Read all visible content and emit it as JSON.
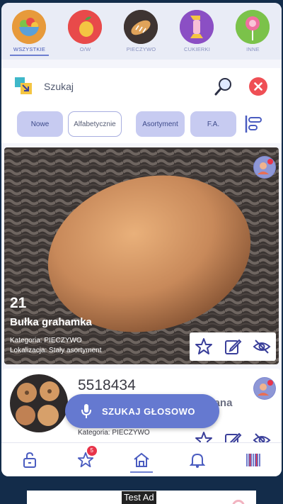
{
  "categories": [
    {
      "label": "WSZYSTKIE",
      "icon": "salad-bowl-icon",
      "color": "#e79a3b",
      "active": true
    },
    {
      "label": "O/W",
      "icon": "fruit-icon",
      "color": "#e84a4a",
      "active": false
    },
    {
      "label": "PIECZYWO",
      "icon": "bread-icon",
      "color": "#3e3432",
      "active": false
    },
    {
      "label": "CUKIERKI",
      "icon": "candy-icon",
      "color": "#8b4fc4",
      "active": false
    },
    {
      "label": "INNE",
      "icon": "lollipop-icon",
      "color": "#7bc24a",
      "active": false
    }
  ],
  "search": {
    "label": "Szukaj"
  },
  "filters": {
    "new": "Nowe",
    "alphabetical": "Alfabetycznie",
    "assortment": "Asortyment",
    "fa": "F.A."
  },
  "products": [
    {
      "number": "21",
      "name": "Bułka grahamka",
      "category": "Kategoria: PIECZYWO",
      "location": "Lokalizacja: Stały asortyment"
    },
    {
      "number": "5518434",
      "name": "Bułka z ziarnami ziemniaczana 6718",
      "category": "Kategoria: PIECZYWO"
    }
  ],
  "voice_button": "SZUKAJ GŁOSOWO",
  "nav": {
    "favorites_count": "5"
  },
  "ad": {
    "label": "Test Ad"
  },
  "colors": {
    "accent": "#6579d0",
    "close": "#ef4f55",
    "nav_active": "#6d7fd0"
  }
}
